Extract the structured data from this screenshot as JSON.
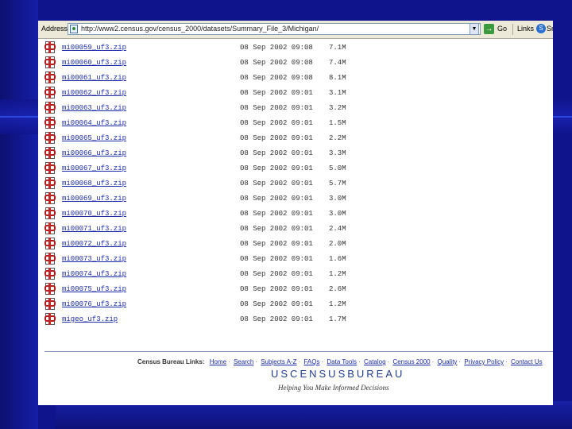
{
  "toolbar": {
    "address_label": "Address",
    "url": "http://www2.census.gov/census_2000/datasets/Summary_File_3/Michigan/",
    "dropdown_glyph": "▼",
    "go_icon": "go-arrow-icon",
    "go_label": "Go",
    "links_label": "Links",
    "snag_label": "Sn"
  },
  "files": [
    {
      "name": "mi00059_uf3.zip",
      "date": "08 Sep 2002 09:08",
      "size": "7.1M"
    },
    {
      "name": "mi00060_uf3.zip",
      "date": "08 Sep 2002 09:08",
      "size": "7.4M"
    },
    {
      "name": "mi00061_uf3.zip",
      "date": "08 Sep 2002 09:08",
      "size": "8.1M"
    },
    {
      "name": "mi00062_uf3.zip",
      "date": "08 Sep 2002 09:01",
      "size": "3.1M"
    },
    {
      "name": "mi00063_uf3.zip",
      "date": "08 Sep 2002 09:01",
      "size": "3.2M"
    },
    {
      "name": "mi00064_uf3.zip",
      "date": "08 Sep 2002 09:01",
      "size": "1.5M"
    },
    {
      "name": "mi00065_uf3.zip",
      "date": "08 Sep 2002 09:01",
      "size": "2.2M"
    },
    {
      "name": "mi00066_uf3.zip",
      "date": "08 Sep 2002 09:01",
      "size": "3.3M"
    },
    {
      "name": "mi00067_uf3.zip",
      "date": "08 Sep 2002 09:01",
      "size": "5.0M"
    },
    {
      "name": "mi00068_uf3.zip",
      "date": "08 Sep 2002 09:01",
      "size": "5.7M"
    },
    {
      "name": "mi00069_uf3.zip",
      "date": "08 Sep 2002 09:01",
      "size": "3.0M"
    },
    {
      "name": "mi00070_uf3.zip",
      "date": "08 Sep 2002 09:01",
      "size": "3.0M"
    },
    {
      "name": "mi00071_uf3.zip",
      "date": "08 Sep 2002 09:01",
      "size": "2.4M"
    },
    {
      "name": "mi00072_uf3.zip",
      "date": "08 Sep 2002 09:01",
      "size": "2.0M"
    },
    {
      "name": "mi00073_uf3.zip",
      "date": "08 Sep 2002 09:01",
      "size": "1.6M"
    },
    {
      "name": "mi00074_uf3.zip",
      "date": "08 Sep 2002 09:01",
      "size": "1.2M"
    },
    {
      "name": "mi00075_uf3.zip",
      "date": "08 Sep 2002 09:01",
      "size": "2.6M"
    },
    {
      "name": "mi00076_uf3.zip",
      "date": "08 Sep 2002 09:01",
      "size": "1.2M"
    },
    {
      "name": "migeo_uf3.zip",
      "date": "08 Sep 2002 09:01",
      "size": "1.7M"
    }
  ],
  "footer": {
    "links_label": "Census Bureau Links:",
    "links": [
      "Home",
      "Search",
      "Subjects A-Z",
      "FAQs",
      "Data Tools",
      "Catalog",
      "Census 2000",
      "Quality",
      "Privacy Policy",
      "Contact Us"
    ],
    "separator": "·",
    "logo_text": "USCENSUSBUREAU",
    "tagline": "Helping You Make Informed Decisions"
  },
  "colors": {
    "slide_background": "#10148c",
    "link": "#1a2aa8",
    "logo": "#1f3d8c"
  }
}
